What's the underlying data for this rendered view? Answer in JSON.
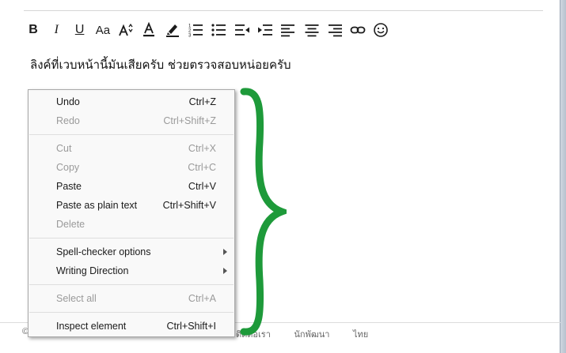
{
  "editor": {
    "message": "ลิงค์ที่เวบหน้านี้มันเสียครับ ช่วยตรวจสอบหน่อยครับ",
    "toolbar": {
      "bold": "B",
      "italic": "I",
      "underline": "U",
      "font": "Aa"
    }
  },
  "footer": {
    "left_glyph": "©",
    "links": [
      "ติดต่อเรา",
      "นักพัฒนา",
      "ไทย"
    ]
  },
  "annotation": {
    "brace_color": "#1e9a3a"
  },
  "context_menu": {
    "items": [
      {
        "label": "Undo",
        "shortcut": "Ctrl+Z"
      },
      {
        "label": "Redo",
        "shortcut": "Ctrl+Shift+Z"
      },
      {
        "label": "Cut",
        "shortcut": "Ctrl+X"
      },
      {
        "label": "Copy",
        "shortcut": "Ctrl+C"
      },
      {
        "label": "Paste",
        "shortcut": "Ctrl+V"
      },
      {
        "label": "Paste as plain text",
        "shortcut": "Ctrl+Shift+V"
      },
      {
        "label": "Delete",
        "shortcut": ""
      },
      {
        "label": "Spell-checker options",
        "shortcut": ""
      },
      {
        "label": "Writing Direction",
        "shortcut": ""
      },
      {
        "label": "Select all",
        "shortcut": "Ctrl+A"
      },
      {
        "label": "Inspect element",
        "shortcut": "Ctrl+Shift+I"
      }
    ]
  }
}
